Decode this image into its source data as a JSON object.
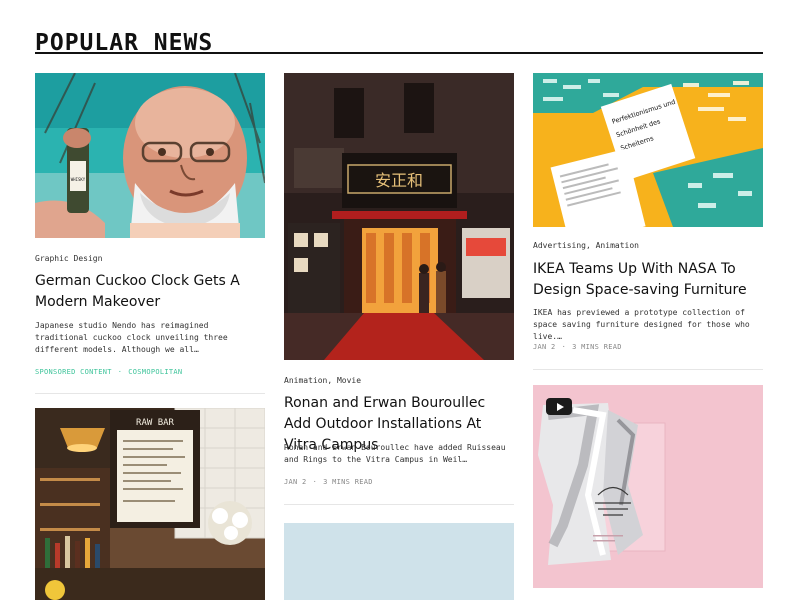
{
  "section": {
    "title": "POPULAR NEWS"
  },
  "articles": [
    {
      "category": "Graphic Design",
      "headline": "German Cuckoo Clock Gets A Modern Makeover",
      "excerpt": "Japanese studio Nendo has reimagined traditional cuckoo clock unveiling three different models. Although we all…",
      "meta": [
        "SPONSORED CONTENT",
        "COSMOPOLITAN"
      ],
      "image": "mural-portrait-image"
    },
    {
      "category": "Animation, Movie",
      "headline": "Ronan and Erwan Bouroullec Add Outdoor Installations At Vitra Campus",
      "excerpt": "Ronan and Erwan Bouroullec have added Ruisseau and Rings to the Vitra Campus in Weil…",
      "meta": [
        "JAN 2",
        "3 MINS READ"
      ],
      "image": "storefront-night-image"
    },
    {
      "category": "Advertising, Animation",
      "headline": "IKEA Teams Up With NASA To Design Space-saving Furniture",
      "excerpt": "IKEA has previewed a prototype collection of space saving furniture designed for those who live.…",
      "meta": [
        "JAN 2",
        "3 MINS READ"
      ],
      "image": "print-design-image"
    }
  ],
  "images": {
    "print_text": [
      "Perfektionismus und",
      "Schönheit des",
      "Scheiterns"
    ],
    "mural_label": "WHISKY",
    "raw_bar": "RAW BAR",
    "sign_chars": "安正和"
  },
  "colors": {
    "accent": "#3fc49b",
    "text": "#111111",
    "muted": "#888888"
  },
  "icons": [
    "play-icon"
  ]
}
